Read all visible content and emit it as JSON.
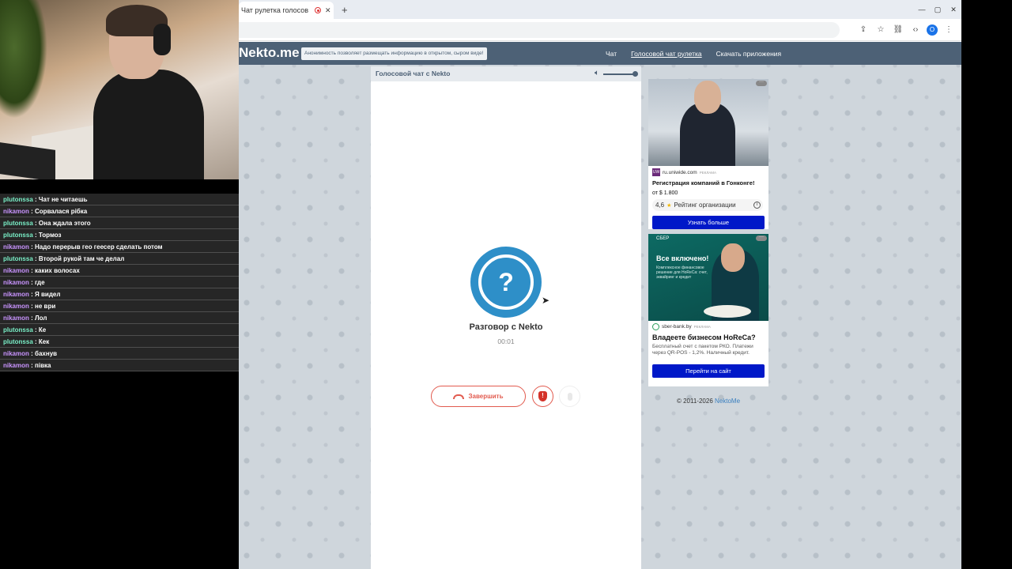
{
  "browser": {
    "tab_title": "Чат рулетка голосов",
    "tab_close": "✕",
    "new_tab": "+",
    "window_controls": [
      "—",
      "▢",
      "✕"
    ],
    "avatar_letter": "O"
  },
  "site": {
    "logo": "Nekto.me",
    "notice": "Анонимность позволяет размещать информацию в открытом, сыром виде!",
    "nav": [
      "Чат",
      "Голосовой чат рулетка",
      "Скачать приложения"
    ],
    "panel_title": "Голосовой чат с Nekto",
    "status_title": "Разговор с Nekto",
    "timer": "00:01",
    "end_button": "Завершить",
    "footer_text": "© 2011-2026",
    "footer_link": "NektoMe"
  },
  "ads": [
    {
      "source": "ru.uniwide.com",
      "tag": "РЕКЛАМА",
      "title": "Регистрация компаний в Гонконге!",
      "price": "от $ 1.800",
      "rating": "4,6",
      "rating_label": "Рейтинг организации",
      "cta": "Узнать больше"
    },
    {
      "brand": "СБЕР",
      "headline": "Все включено!",
      "subline": "Комплексное финансовое решение для HoReCa: счет, эквайринг и кредит",
      "source": "sber-bank.by",
      "tag": "РЕКЛАМА",
      "title": "Владеете бизнесом HoReCa?",
      "desc": "Бесплатный счет с пакетом РКО. Платежи через QR-POS - 1,2%. Наличный кредит.",
      "cta": "Перейти на сайт"
    }
  ],
  "chat": [
    {
      "user": "plutonssa",
      "text": "Чат не читаешь"
    },
    {
      "user": "nikamon",
      "text": "Сорвалася рібка"
    },
    {
      "user": "plutonssa",
      "text": "Она ждала этого"
    },
    {
      "user": "plutonssa",
      "text": "Тормоз"
    },
    {
      "user": "nikamon",
      "text": "Надо перерыв гео геесер сделать потом"
    },
    {
      "user": "plutonssa",
      "text": "Второй рукой там че делал"
    },
    {
      "user": "nikamon",
      "text": "каких волосах"
    },
    {
      "user": "nikamon",
      "text": "где"
    },
    {
      "user": "nikamon",
      "text": "Я видел"
    },
    {
      "user": "nikamon",
      "text": "не ври"
    },
    {
      "user": "nikamon",
      "text": "Лол"
    },
    {
      "user": "plutonssa",
      "text": "Ке"
    },
    {
      "user": "plutonssa",
      "text": "Кек"
    },
    {
      "user": "nikamon",
      "text": "бахнув"
    },
    {
      "user": "nikamon",
      "text": "пiвка"
    }
  ],
  "colors": {
    "accent_blue": "#2e8fc8",
    "danger_red": "#e25b4f",
    "nav_bg": "#4d6176",
    "ad_cta": "#0018c8"
  }
}
